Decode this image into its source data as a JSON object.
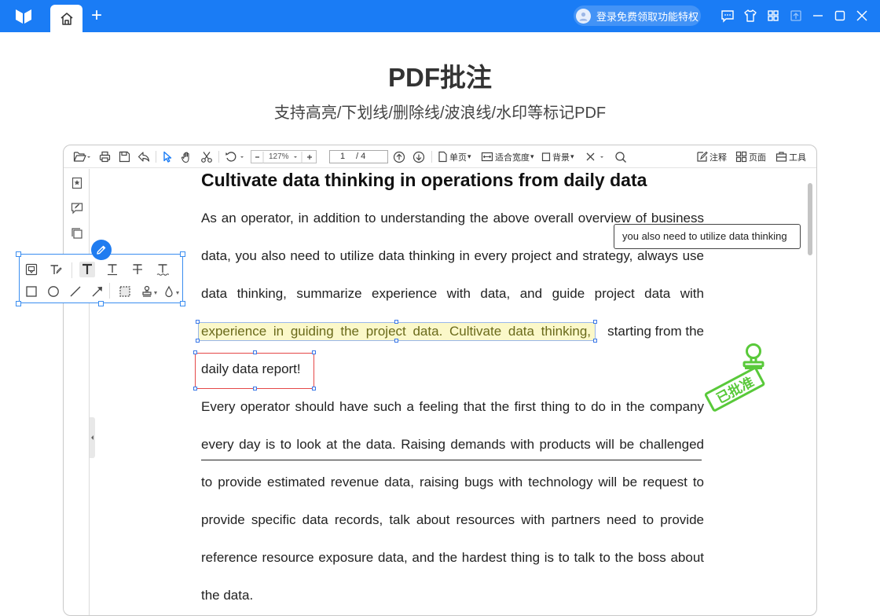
{
  "app": {
    "login_text": "登录免费领取功能特权"
  },
  "hero": {
    "title": "PDF批注",
    "subtitle": "支持高亮/下划线/删除线/波浪线/水印等标记PDF"
  },
  "toolbar": {
    "zoom": "127%",
    "page_current": "1",
    "page_total": "/ 4",
    "single_page_label": "单页",
    "fit_width_label": "适合宽度",
    "background_label": "背景",
    "annotate_label": "注释",
    "page_label": "页面",
    "tools_label": "工具"
  },
  "document": {
    "heading": "Cultivate data thinking in operations from daily data",
    "lines": [
      "As an operator, in addition to understanding the above overall overview of business",
      "data, you also need to utilize data thinking in every project and strategy, always use",
      "data thinking, summarize experience with data, and guide project data with",
      "experience in guiding the project data. Cultivate data thinking,",
      "starting from the",
      "daily data report!",
      "Every operator should have such a feeling that the first thing to do in the company",
      "every day is to look at the data. Raising demands with products will be challenged",
      "to provide estimated revenue data, raising bugs with technology will be request to",
      "provide specific data records, talk about resources with partners need to provide",
      "reference resource exposure data, and the hardest thing is to talk to the boss about",
      "the data."
    ],
    "comment_text": "you also need to utilize data thinking",
    "stamp_text": "已批准"
  },
  "colors": {
    "accent": "#1a7cf5",
    "highlight": "#fbf8c9",
    "rectangle": "#e54848",
    "stamp": "#59c93a"
  }
}
